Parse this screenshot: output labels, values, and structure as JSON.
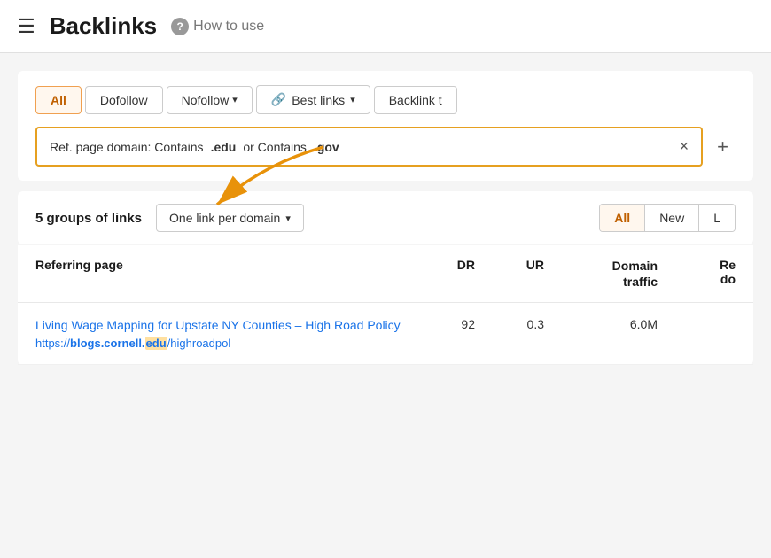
{
  "header": {
    "menu_icon": "☰",
    "title": "Backlinks",
    "help_icon": "?",
    "how_to_use": "How to use"
  },
  "filters": {
    "tabs": [
      {
        "id": "all",
        "label": "All",
        "active": true,
        "dropdown": false
      },
      {
        "id": "dofollow",
        "label": "Dofollow",
        "active": false,
        "dropdown": false
      },
      {
        "id": "nofollow",
        "label": "Nofollow",
        "active": false,
        "dropdown": true
      },
      {
        "id": "best-links",
        "label": "Best links",
        "active": false,
        "dropdown": true,
        "icon": "🔗"
      },
      {
        "id": "backlink-type",
        "label": "Backlink t",
        "active": false,
        "dropdown": false
      }
    ],
    "active_filter": {
      "text_prefix": "Ref. page domain: Contains ",
      "value1": ".edu",
      "text_middle": " or Contains ",
      "value2": ".gov"
    },
    "clear_label": "×",
    "add_label": "+"
  },
  "results": {
    "groups_label": "5 groups of links",
    "group_dropdown": "One link per domain",
    "view_tabs": [
      {
        "id": "all",
        "label": "All",
        "active": true
      },
      {
        "id": "new",
        "label": "New",
        "active": false
      },
      {
        "id": "lost",
        "label": "L",
        "active": false
      }
    ]
  },
  "table": {
    "columns": [
      {
        "id": "referring-page",
        "label": "Referring page"
      },
      {
        "id": "dr",
        "label": "DR"
      },
      {
        "id": "ur",
        "label": "UR"
      },
      {
        "id": "domain-traffic",
        "label": "Domain\ntraffic"
      },
      {
        "id": "re-do",
        "label": "Re do"
      }
    ],
    "rows": [
      {
        "title": "Living Wage Mapping for Upstate NY Counties – High Road Policy",
        "url_prefix": "https://blogs.cornell.",
        "url_bold": "edu",
        "url_suffix": "/highroadpol",
        "url_highlight": "edu",
        "dr": "92",
        "ur": "0.3",
        "domain_traffic": "6.0M",
        "re_do": ""
      }
    ]
  }
}
